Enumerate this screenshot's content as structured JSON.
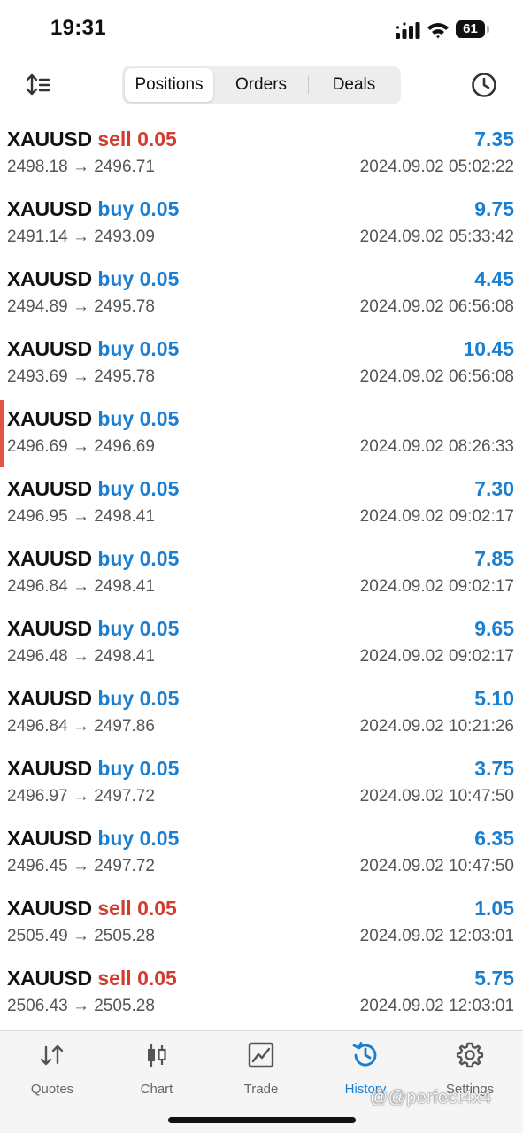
{
  "status_bar": {
    "time": "19:31",
    "battery": "61"
  },
  "toolbar": {
    "tabs": [
      {
        "label": "Positions",
        "active": true
      },
      {
        "label": "Orders",
        "active": false
      },
      {
        "label": "Deals",
        "active": false
      }
    ],
    "sort_icon": "sort-icon",
    "history_icon": "clock-icon"
  },
  "deals": [
    {
      "symbol": "XAUUSD",
      "side": "sell",
      "volume": "0.05",
      "profit": "7.35",
      "prices": "2498.18 → 2496.71",
      "time": "2024.09.02 05:02:22"
    },
    {
      "symbol": "XAUUSD",
      "side": "buy",
      "volume": "0.05",
      "profit": "9.75",
      "prices": "2491.14 → 2493.09",
      "time": "2024.09.02 05:33:42"
    },
    {
      "symbol": "XAUUSD",
      "side": "buy",
      "volume": "0.05",
      "profit": "4.45",
      "prices": "2494.89 → 2495.78",
      "time": "2024.09.02 06:56:08"
    },
    {
      "symbol": "XAUUSD",
      "side": "buy",
      "volume": "0.05",
      "profit": "10.45",
      "prices": "2493.69 → 2495.78",
      "time": "2024.09.02 06:56:08"
    },
    {
      "symbol": "XAUUSD",
      "side": "buy",
      "volume": "0.05",
      "profit": "",
      "prices": "2496.69 → 2496.69",
      "time": "2024.09.02 08:26:33",
      "marker": true
    },
    {
      "symbol": "XAUUSD",
      "side": "buy",
      "volume": "0.05",
      "profit": "7.30",
      "prices": "2496.95 → 2498.41",
      "time": "2024.09.02 09:02:17"
    },
    {
      "symbol": "XAUUSD",
      "side": "buy",
      "volume": "0.05",
      "profit": "7.85",
      "prices": "2496.84 → 2498.41",
      "time": "2024.09.02 09:02:17"
    },
    {
      "symbol": "XAUUSD",
      "side": "buy",
      "volume": "0.05",
      "profit": "9.65",
      "prices": "2496.48 → 2498.41",
      "time": "2024.09.02 09:02:17"
    },
    {
      "symbol": "XAUUSD",
      "side": "buy",
      "volume": "0.05",
      "profit": "5.10",
      "prices": "2496.84 → 2497.86",
      "time": "2024.09.02 10:21:26"
    },
    {
      "symbol": "XAUUSD",
      "side": "buy",
      "volume": "0.05",
      "profit": "3.75",
      "prices": "2496.97 → 2497.72",
      "time": "2024.09.02 10:47:50"
    },
    {
      "symbol": "XAUUSD",
      "side": "buy",
      "volume": "0.05",
      "profit": "6.35",
      "prices": "2496.45 → 2497.72",
      "time": "2024.09.02 10:47:50"
    },
    {
      "symbol": "XAUUSD",
      "side": "sell",
      "volume": "0.05",
      "profit": "1.05",
      "prices": "2505.49 → 2505.28",
      "time": "2024.09.02 12:03:01"
    },
    {
      "symbol": "XAUUSD",
      "side": "sell",
      "volume": "0.05",
      "profit": "5.75",
      "prices": "2506.43 → 2505.28",
      "time": "2024.09.02 12:03:01"
    }
  ],
  "colors": {
    "buy": "#1a7fd0",
    "sell": "#d23b2e",
    "profit": "#1a7fd0",
    "marker": "#e0574a"
  },
  "tab_bar": [
    {
      "label": "Quotes",
      "icon": "quotes-arrows-icon",
      "active": false
    },
    {
      "label": "Chart",
      "icon": "candlestick-chart-icon",
      "active": false
    },
    {
      "label": "Trade",
      "icon": "trade-chart-icon",
      "active": false
    },
    {
      "label": "History",
      "icon": "history-icon",
      "active": true
    },
    {
      "label": "Settings",
      "icon": "gear-icon",
      "active": false
    }
  ],
  "watermark": "@@perfect4x4"
}
